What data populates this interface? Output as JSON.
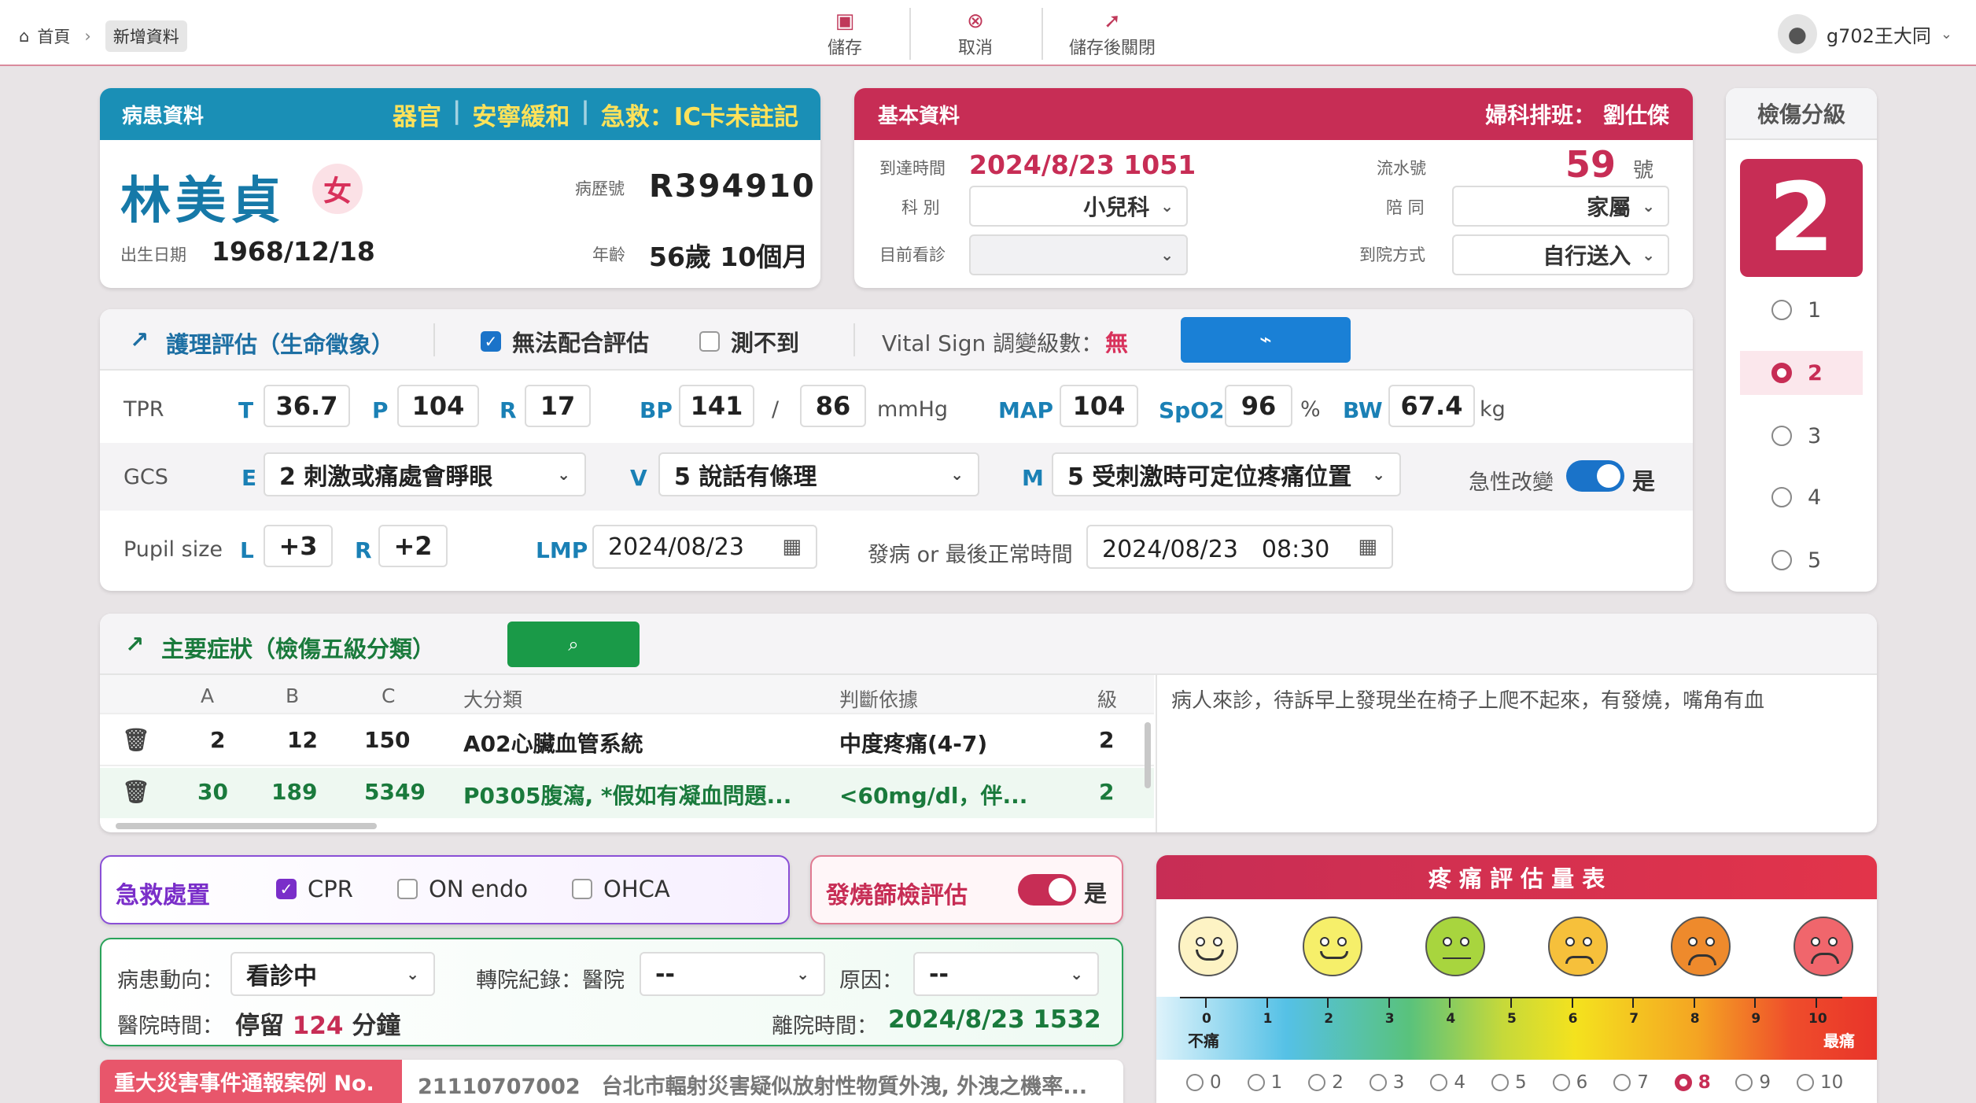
{
  "breadcrumb": {
    "home": "首頁",
    "current": "新增資料"
  },
  "toolbar": {
    "save": "儲存",
    "cancel": "取消",
    "save_close": "儲存後關閉"
  },
  "user": {
    "name": "g702王大同"
  },
  "patient": {
    "header": "病患資料",
    "tag1": "器官",
    "tag2": "安寧緩和",
    "tag3": "急救：IC卡未註記",
    "name": "林美貞",
    "sex": "女",
    "chart_no_label": "病歷號",
    "chart_no": "R394910",
    "dob_label": "出生日期",
    "dob": "1968/12/18",
    "age_label": "年齡",
    "age": "56歲 10個月"
  },
  "basic": {
    "header": "基本資料",
    "duty": "婦科排班： 劉仕傑",
    "arrival_label": "到達時間",
    "arrival": "2024/8/23 1051",
    "serial_label": "流水號",
    "serial": "59",
    "serial_unit": "號",
    "dept_label": "科 別",
    "dept": "小兒科",
    "companion_label": "陪 同",
    "companion": "家屬",
    "current_label": "目前看診",
    "current": "",
    "mode_label": "到院方式",
    "mode": "自行送入"
  },
  "triage": {
    "header": "檢傷分級",
    "level": "2",
    "options": [
      "1",
      "2",
      "3",
      "4",
      "5"
    ],
    "selected": "2"
  },
  "nursing": {
    "title": "護理評估（生命徵象）",
    "cb1": "無法配合評估",
    "cb2": "測不到",
    "vital_label": "Vital Sign 調變級數：",
    "vital_value": "無",
    "tpr": "TPR",
    "T": "36.7",
    "P": "104",
    "R": "17",
    "BP_sys": "141",
    "BP_dia": "86",
    "bp_unit": "mmHg",
    "MAP": "104",
    "SpO2": "96",
    "spo2_unit": "%",
    "BW": "67.4",
    "bw_unit": "kg",
    "gcs": "GCS",
    "E": "2 刺激或痛處會睜眼",
    "V": "5 說話有條理",
    "M": "5 受刺激時可定位疼痛位置",
    "acute_label": "急性改變",
    "acute_value": "是",
    "pupil": "Pupil size",
    "L": "+3",
    "Rp": "+2",
    "lmp_label": "LMP",
    "lmp": "2024/08/23",
    "onset_label": "發病 or 最後正常時間",
    "onset": "2024/08/23　08:30"
  },
  "symptoms": {
    "title": "主要症狀（檢傷五級分類）",
    "headers": [
      "A",
      "B",
      "C",
      "大分類",
      "判斷依據",
      "級"
    ],
    "rows": [
      [
        "2",
        "12",
        "150",
        "A02心臟血管系統",
        "中度疼痛(4-7)",
        "2"
      ],
      [
        "30",
        "189",
        "5349",
        "P0305腹瀉, *假如有凝血問題...",
        "<60mg/dl，伴...",
        "2"
      ]
    ],
    "note": "病人來診，待訴早上發現坐在椅子上爬不起來，有發燒，嘴角有血"
  },
  "rescue": {
    "title": "急救處置",
    "o1": "CPR",
    "o2": "ON endo",
    "o3": "OHCA"
  },
  "fever": {
    "title": "發燒篩檢評估",
    "value": "是"
  },
  "disposition": {
    "status_label": "病患動向：",
    "status": "看診中",
    "transfer_label": "轉院紀錄：醫院",
    "transfer": "--",
    "reason_label": "原因：",
    "reason": "--",
    "stay_label": "醫院時間：",
    "stay_prefix": "停留",
    "stay_value": "124",
    "stay_unit": "分鐘",
    "leave_label": "離院時間：",
    "leave": "2024/8/23 1532"
  },
  "disaster": {
    "label": "重大災害事件通報案例 No.",
    "value": "21110707002　台北市輻射災害疑似放射性物質外洩, 外洩之機率..."
  },
  "pain": {
    "title": "疼 痛 評 估 量 表",
    "ticks": [
      "0",
      "1",
      "2",
      "3",
      "4",
      "5",
      "6",
      "7",
      "8",
      "9",
      "10"
    ],
    "left_label": "不痛",
    "right_label": "最痛",
    "selected": "8"
  },
  "colors": {
    "accent_red": "#c72d55",
    "accent_blue": "#1a8fb6",
    "accent_green": "#1a9a48"
  }
}
